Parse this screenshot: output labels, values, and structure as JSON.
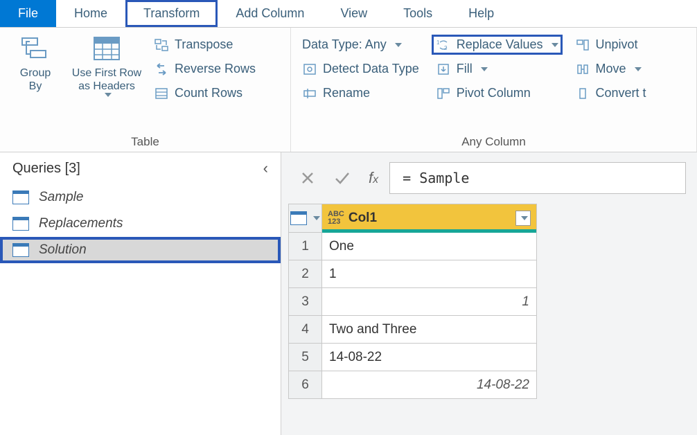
{
  "tabs": {
    "file": "File",
    "home": "Home",
    "transform": "Transform",
    "add_column": "Add Column",
    "view": "View",
    "tools": "Tools",
    "help": "Help"
  },
  "ribbon": {
    "table": {
      "label": "Table",
      "group_by": "Group\nBy",
      "use_first_row": "Use First Row\nas Headers",
      "transpose": "Transpose",
      "reverse_rows": "Reverse Rows",
      "count_rows": "Count Rows"
    },
    "any_column": {
      "label": "Any Column",
      "data_type": "Data Type: Any",
      "detect": "Detect Data Type",
      "rename": "Rename",
      "replace_values": "Replace Values",
      "fill": "Fill",
      "pivot": "Pivot Column",
      "unpivot": "Unpivot",
      "move": "Move",
      "convert": "Convert t"
    }
  },
  "queries": {
    "title": "Queries [3]",
    "items": [
      {
        "name": "Sample"
      },
      {
        "name": "Replacements"
      },
      {
        "name": "Solution"
      }
    ]
  },
  "formula": {
    "value": "= Sample"
  },
  "grid": {
    "column_header": "Col1",
    "rows": [
      {
        "value": "One",
        "italic_right": false
      },
      {
        "value": "1",
        "italic_right": false
      },
      {
        "value": "1",
        "italic_right": true
      },
      {
        "value": "Two and Three",
        "italic_right": false
      },
      {
        "value": "14-08-22",
        "italic_right": false
      },
      {
        "value": "14-08-22",
        "italic_right": true
      }
    ]
  }
}
